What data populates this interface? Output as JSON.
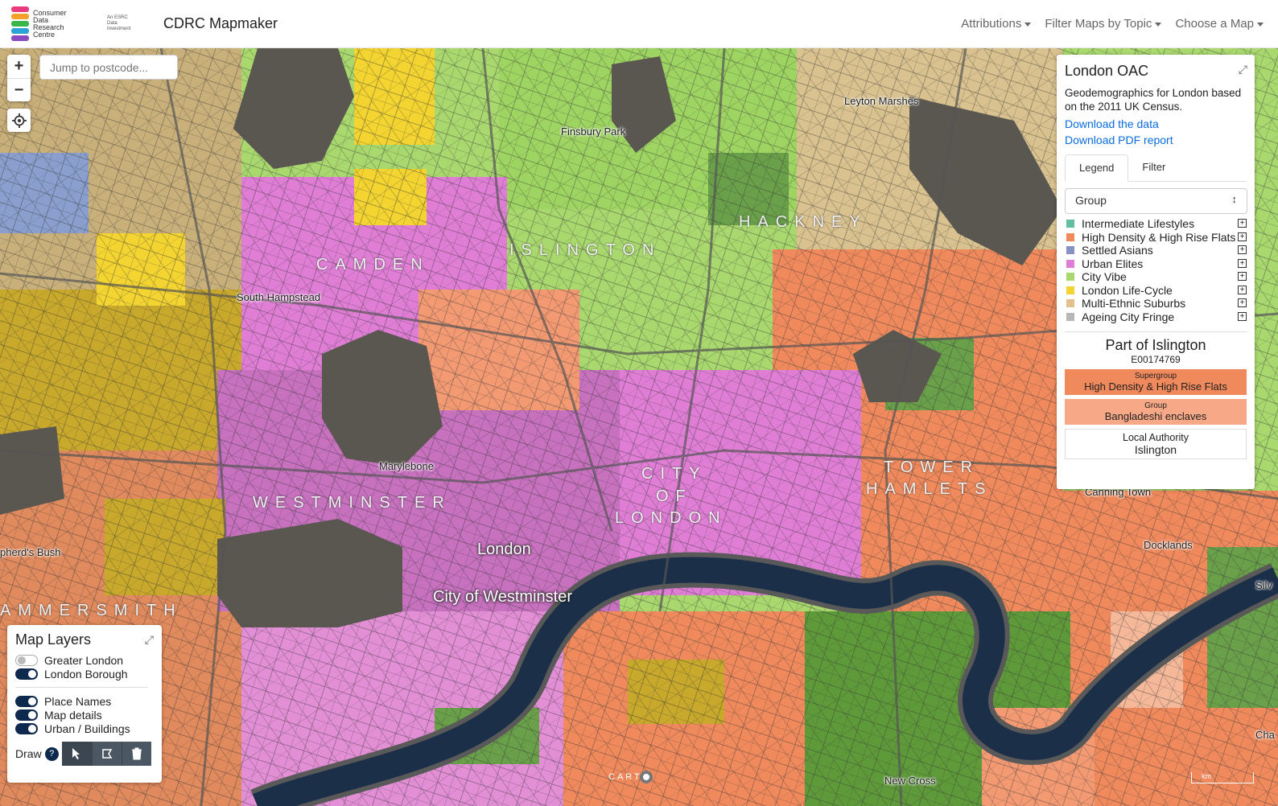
{
  "navbar": {
    "logo_text": "Consumer Data Research Centre",
    "esrc_text": "An ESRC Data Investment",
    "app_title": "CDRC Mapmaker",
    "menu": [
      "Attributions",
      "Filter Maps by Topic",
      "Choose a Map"
    ]
  },
  "map_controls": {
    "zoom_in": "+",
    "zoom_out": "−",
    "postcode_placeholder": "Jump to postcode..."
  },
  "legend_panel": {
    "title": "London OAC",
    "description": "Geodemographics for London based on the 2011 UK Census.",
    "links": [
      "Download the data",
      "Download PDF report"
    ],
    "tabs": [
      "Legend",
      "Filter"
    ],
    "active_tab": "Legend",
    "select_value": "Group",
    "items": [
      {
        "label": "Intermediate Lifestyles",
        "color": "#5fbfa0"
      },
      {
        "label": "High Density & High Rise Flats",
        "color": "#f08a5d"
      },
      {
        "label": "Settled Asians",
        "color": "#8791c5"
      },
      {
        "label": "Urban Elites",
        "color": "#e07ed6"
      },
      {
        "label": "City Vibe",
        "color": "#a9d86e"
      },
      {
        "label": "London Life-Cycle",
        "color": "#f3d431"
      },
      {
        "label": "Multi-Ethnic Suburbs",
        "color": "#e6c08c"
      },
      {
        "label": "Ageing City Fringe",
        "color": "#b7b7b7"
      }
    ],
    "area": {
      "title": "Part of Islington",
      "code": "E00174769",
      "supergroup_label": "Supergroup",
      "supergroup_value": "High Density & High Rise Flats",
      "supergroup_color": "#f08a5d",
      "group_label": "Group",
      "group_value": "Bangladeshi enclaves",
      "group_color": "#f6a887",
      "la_label": "Local Authority",
      "la_value": "Islington"
    }
  },
  "layers_panel": {
    "title": "Map Layers",
    "group1": [
      {
        "label": "Greater London",
        "on": false
      },
      {
        "label": "London Borough",
        "on": true
      }
    ],
    "group2": [
      {
        "label": "Place Names",
        "on": true
      },
      {
        "label": "Map details",
        "on": true
      },
      {
        "label": "Urban / Buildings",
        "on": true
      }
    ],
    "draw_label": "Draw",
    "help": "?"
  },
  "map_labels": {
    "boroughs": [
      "CAMDEN",
      "ISLINGTON",
      "HACKNEY",
      "WESTMINSTER",
      "CITY",
      "OF",
      "LONDON",
      "TOWER",
      "HAMLETS",
      "AMMERSMITH"
    ],
    "places": [
      "Finsbury Park",
      "Leyton Marshes",
      "South Hampstead",
      "Marylebone",
      "Canning Town",
      "Docklands",
      "pherd's Bush",
      "New Cross",
      "Silv",
      "Cha"
    ],
    "cities": [
      "London",
      "City of Westminster"
    ],
    "carto": "CARTO",
    "scale": "km"
  }
}
